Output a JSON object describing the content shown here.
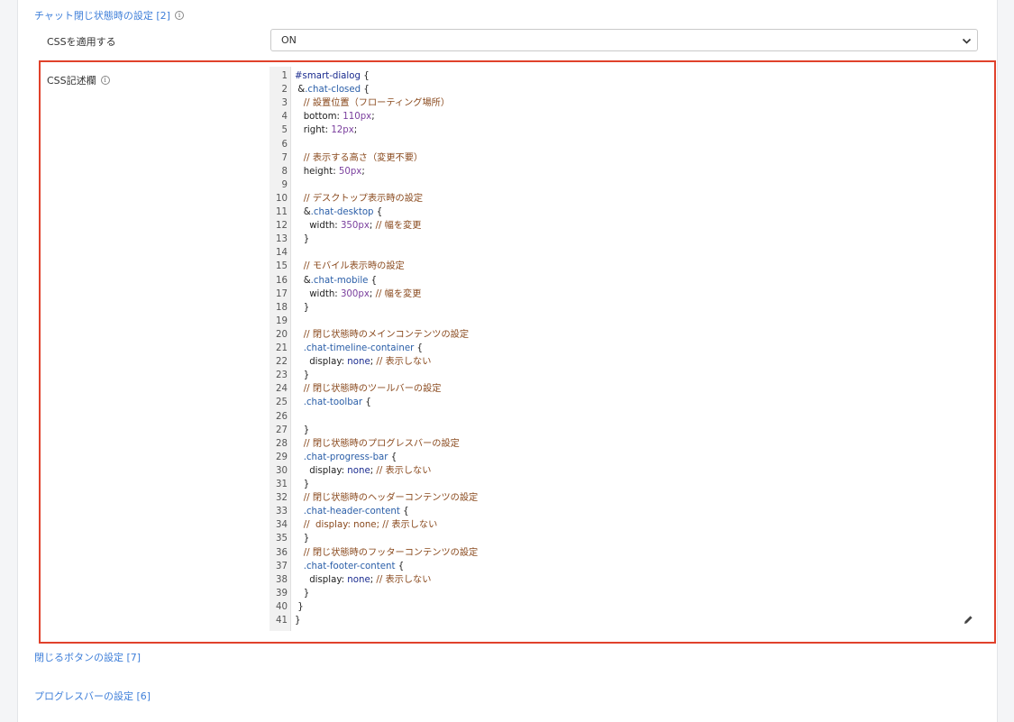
{
  "sections": {
    "chat_closed_settings": "チャット閉じ状態時の設定 [2]",
    "close_button_settings": "閉じるボタンの設定 [7]",
    "progress_bar_settings": "プログレスバーの設定 [6]"
  },
  "apply_css": {
    "label": "CSSを適用する",
    "value": "ON"
  },
  "css_field": {
    "label": "CSS記述欄"
  },
  "icons": {
    "info": "info-icon",
    "edit": "pencil-icon",
    "dropdown": "chevron-down-icon"
  },
  "colors": {
    "link": "#3f7fd9",
    "highlight": "#e0412b"
  },
  "code_lines": [
    [
      [
        "sel",
        "#smart-dialog"
      ],
      [
        "p",
        " {"
      ]
    ],
    [
      [
        "p",
        " &"
      ],
      [
        "cls",
        ".chat-closed"
      ],
      [
        "p",
        " {"
      ]
    ],
    [
      [
        "cm",
        "   // 設置位置（フローティング場所）"
      ]
    ],
    [
      [
        "p",
        "   bottom: "
      ],
      [
        "num",
        "110"
      ],
      [
        "unit",
        "px"
      ],
      [
        "p",
        ";"
      ]
    ],
    [
      [
        "p",
        "   right: "
      ],
      [
        "num",
        "12"
      ],
      [
        "unit",
        "px"
      ],
      [
        "p",
        ";"
      ]
    ],
    [
      [
        "p",
        ""
      ]
    ],
    [
      [
        "cm",
        "   // 表示する高さ（変更不要）"
      ]
    ],
    [
      [
        "p",
        "   height: "
      ],
      [
        "num",
        "50"
      ],
      [
        "unit",
        "px"
      ],
      [
        "p",
        ";"
      ]
    ],
    [
      [
        "p",
        ""
      ]
    ],
    [
      [
        "cm",
        "   // デスクトップ表示時の設定"
      ]
    ],
    [
      [
        "p",
        "   &"
      ],
      [
        "cls",
        ".chat-desktop"
      ],
      [
        "p",
        " {"
      ]
    ],
    [
      [
        "p",
        "     width: "
      ],
      [
        "num",
        "350"
      ],
      [
        "unit",
        "px"
      ],
      [
        "p",
        "; "
      ],
      [
        "cm",
        "// 幅を変更"
      ]
    ],
    [
      [
        "p",
        "   }"
      ]
    ],
    [
      [
        "p",
        ""
      ]
    ],
    [
      [
        "cm",
        "   // モバイル表示時の設定"
      ]
    ],
    [
      [
        "p",
        "   &"
      ],
      [
        "cls",
        ".chat-mobile"
      ],
      [
        "p",
        " {"
      ]
    ],
    [
      [
        "p",
        "     width: "
      ],
      [
        "num",
        "300"
      ],
      [
        "unit",
        "px"
      ],
      [
        "p",
        "; "
      ],
      [
        "cm",
        "// 幅を変更"
      ]
    ],
    [
      [
        "p",
        "   }"
      ]
    ],
    [
      [
        "p",
        ""
      ]
    ],
    [
      [
        "cm",
        "   // 閉じ状態時のメインコンテンツの設定"
      ]
    ],
    [
      [
        "cls",
        "   .chat-timeline-container"
      ],
      [
        "p",
        " {"
      ]
    ],
    [
      [
        "p",
        "     display: "
      ],
      [
        "kw",
        "none"
      ],
      [
        "p",
        "; "
      ],
      [
        "cm",
        "// 表示しない"
      ]
    ],
    [
      [
        "p",
        "   }"
      ]
    ],
    [
      [
        "cm",
        "   // 閉じ状態時のツールバーの設定"
      ]
    ],
    [
      [
        "cls",
        "   .chat-toolbar"
      ],
      [
        "p",
        " {"
      ]
    ],
    [
      [
        "p",
        ""
      ]
    ],
    [
      [
        "p",
        "   }"
      ]
    ],
    [
      [
        "cm",
        "   // 閉じ状態時のプログレスバーの設定"
      ]
    ],
    [
      [
        "cls",
        "   .chat-progress-bar"
      ],
      [
        "p",
        " {"
      ]
    ],
    [
      [
        "p",
        "     display: "
      ],
      [
        "kw",
        "none"
      ],
      [
        "p",
        "; "
      ],
      [
        "cm",
        "// 表示しない"
      ]
    ],
    [
      [
        "p",
        "   }"
      ]
    ],
    [
      [
        "cm",
        "   // 閉じ状態時のヘッダーコンテンツの設定"
      ]
    ],
    [
      [
        "cls",
        "   .chat-header-content"
      ],
      [
        "p",
        " {"
      ]
    ],
    [
      [
        "cm",
        "   //  display: none; // 表示しない"
      ]
    ],
    [
      [
        "p",
        "   }"
      ]
    ],
    [
      [
        "cm",
        "   // 閉じ状態時のフッターコンテンツの設定"
      ]
    ],
    [
      [
        "cls",
        "   .chat-footer-content"
      ],
      [
        "p",
        " {"
      ]
    ],
    [
      [
        "p",
        "     display: "
      ],
      [
        "kw",
        "none"
      ],
      [
        "p",
        "; "
      ],
      [
        "cm",
        "// 表示しない"
      ]
    ],
    [
      [
        "p",
        "   }"
      ]
    ],
    [
      [
        "p",
        " }"
      ]
    ],
    [
      [
        "p",
        "}"
      ]
    ]
  ]
}
